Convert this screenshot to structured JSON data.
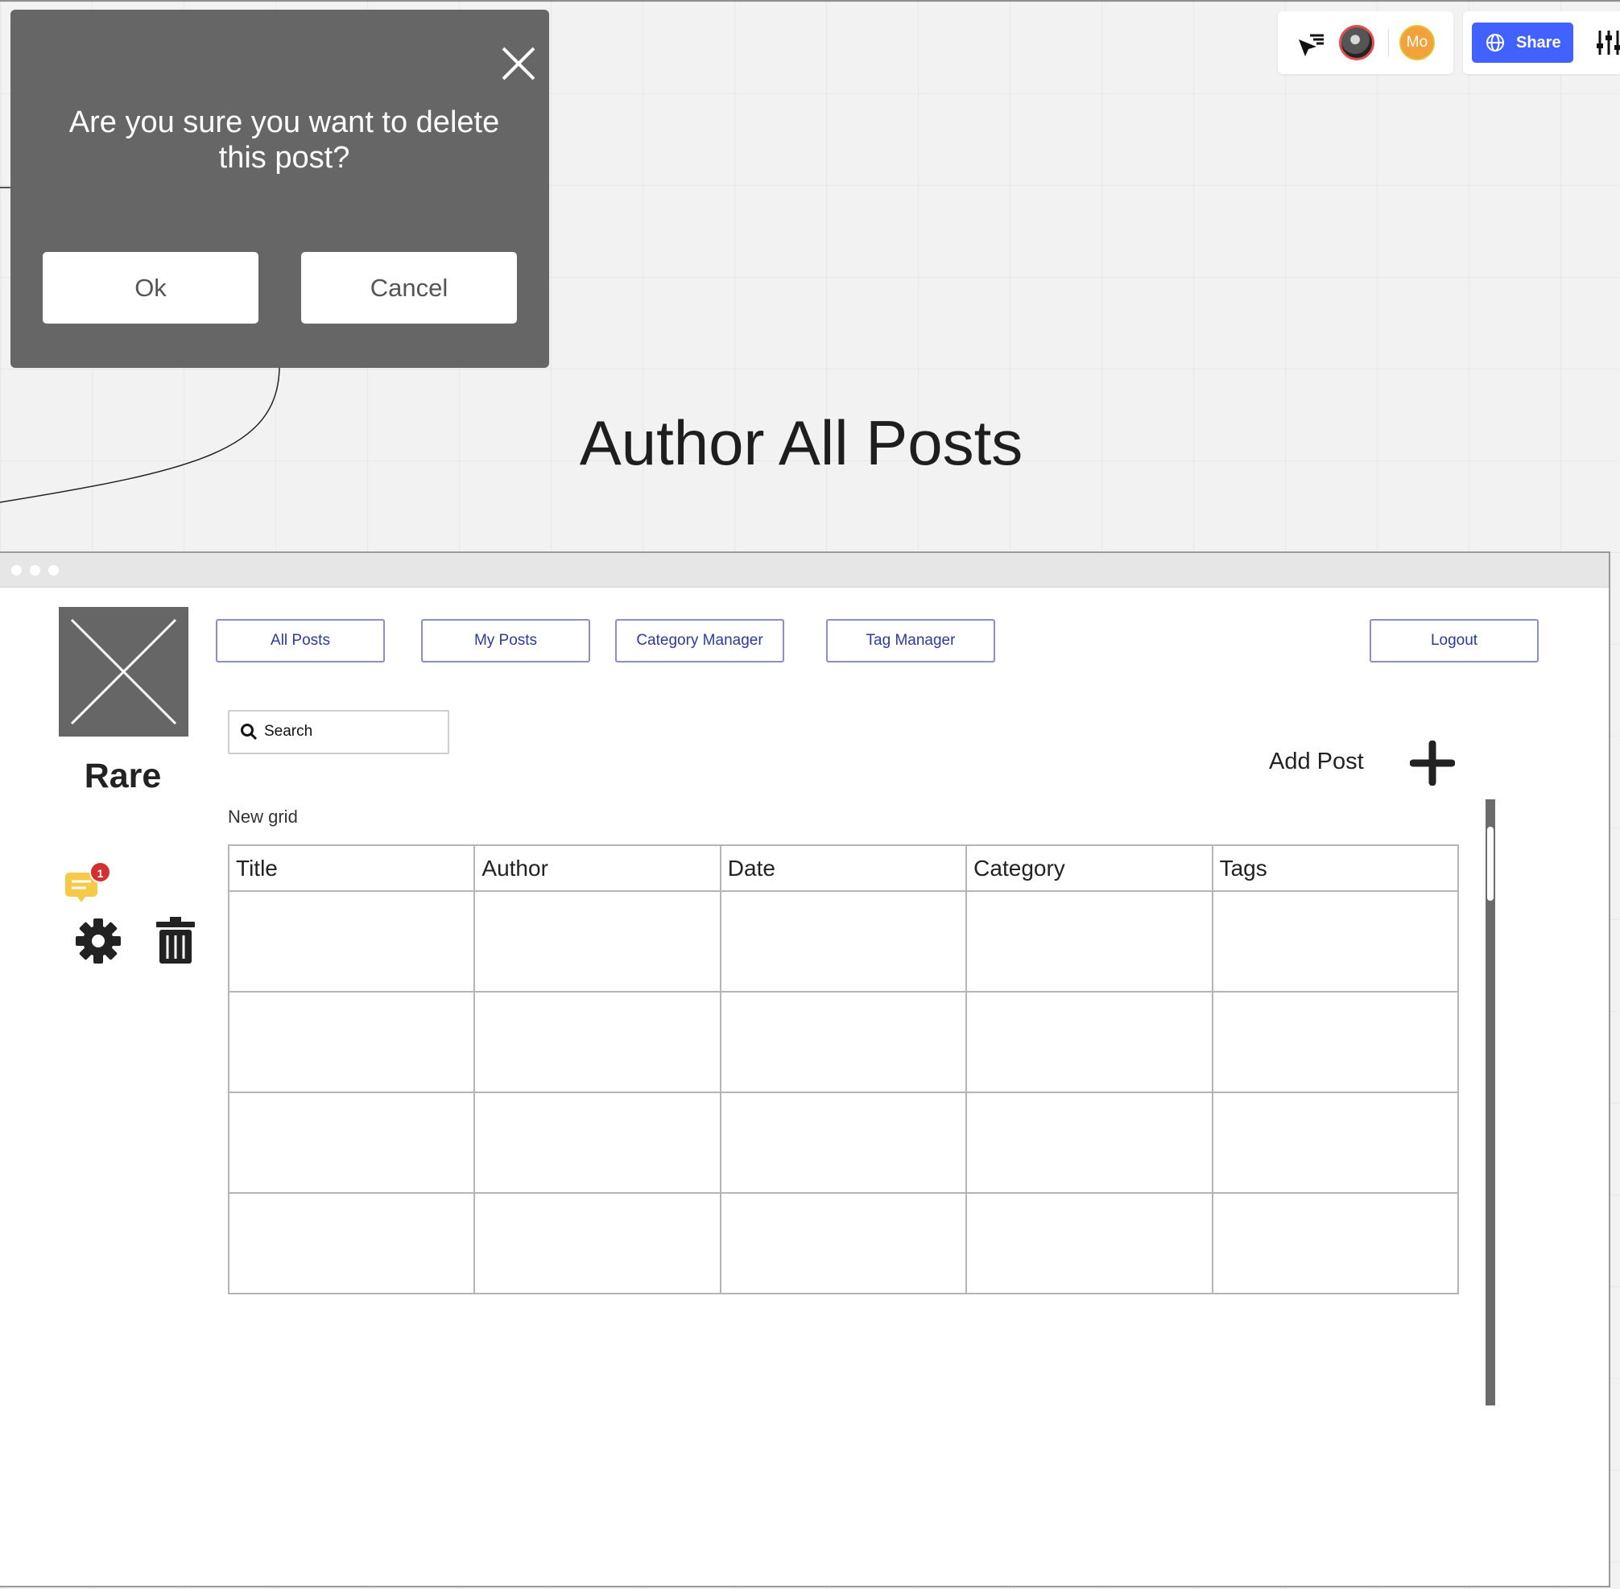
{
  "board": {
    "title": "Author All Posts"
  },
  "toolbar": {
    "cursor_icon": "cursor-filter-icon",
    "avatar_initials": "Mo",
    "share_label": "Share",
    "share_color": "#4262ff"
  },
  "dialog": {
    "message": "Are you sure you want to delete this post?",
    "ok_label": "Ok",
    "cancel_label": "Cancel",
    "background": "#666666"
  },
  "app": {
    "brand": "Rare",
    "nav": [
      {
        "label": "All Posts"
      },
      {
        "label": "My Posts"
      },
      {
        "label": "Category Manager"
      },
      {
        "label": "Tag Manager"
      }
    ],
    "logout_label": "Logout",
    "search_placeholder": "Search",
    "add_post_label": "Add Post",
    "grid_label": "New grid",
    "columns": [
      "Title",
      "Author",
      "Date",
      "Category",
      "Tags"
    ],
    "row_count": 4,
    "comment_badge": "1"
  }
}
